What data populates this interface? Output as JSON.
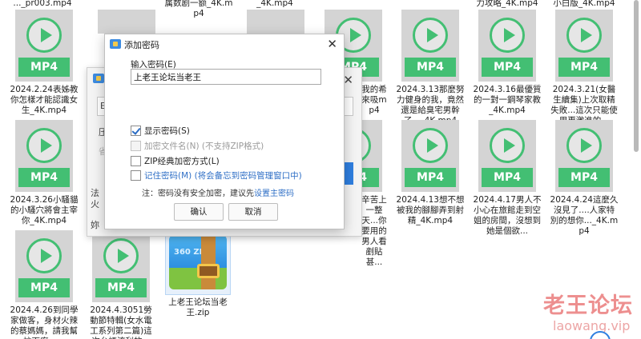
{
  "top_row_partial": [
    "..._pr003.mp4",
    "属数剧一额_4K.mp4",
    "_4K.mp4",
    "力攻略_4K.mp4",
    "小白版_4K.mp4"
  ],
  "files_row1": [
    {
      "name": "2024.2.24表姊教你怎樣才能認識女生_4K.mp4",
      "badge": "MP4"
    },
    {
      "name": "2024.3.13那麼努力健身的我，竟然還是給臭宅男幹了..._4K.mp4",
      "badge": "MP4"
    },
    {
      "name": "2024.3.16最優質的一對一鋼琴家教_4K.mp4",
      "badge": "MP4"
    },
    {
      "name": "2024.3.21(女醫生續集)上次取精失敗...這次只能使用更激進的...",
      "badge": "MP4"
    }
  ],
  "partial_row1_text": "我的希來吸mp4",
  "files_row2": [
    {
      "name": "2024.3.26小騷貓的小騷穴將會主宰你_4K.mp4",
      "badge": "MP4"
    },
    {
      "name": "2024.4.13想不想被我的腳腳弄到射精_4K.mp4",
      "badge": "MP4"
    },
    {
      "name": "2024.4.17男人不小心在旅館走到空姐的房間，沒想到她是個欲...",
      "badge": "MP4"
    },
    {
      "name": "2024.4.24這麼久沒見了....人家特別的想你..._4K.mp4",
      "badge": "MP4"
    }
  ],
  "partial_row2_text": "辛苦上一整天...你要用的男人看剷貼甚...",
  "files_row3": [
    {
      "name": "2024.4.26到同學家做客，身材火辣的蔡媽媽，請我幫忙下廚，...",
      "badge": "MP4"
    },
    {
      "name": "2024.4.3051勞動節特輯(女水電工系列第二篇)這次台語流利的...",
      "badge": "MP4"
    },
    {
      "name": "上老王论坛当老王.zip",
      "badge": "360 ZIP"
    }
  ],
  "bg_dialog": {
    "frag1": "E",
    "frag2": "压",
    "frag3": "火",
    "frag4": "法",
    "frag5": "妳",
    "frag6": "省"
  },
  "dialog": {
    "title": "添加密码",
    "prompt_label": "输入密码(E)",
    "password_value": "上老王论坛当老王",
    "show_password": {
      "label": "显示密码(S)",
      "checked": true
    },
    "encrypt_names": {
      "label": "加密文件名(N) (不支持ZIP格式)",
      "checked": false,
      "disabled": true
    },
    "zip_classic": {
      "label": "ZIP经典加密方式(L)",
      "checked": false
    },
    "remember": {
      "label": "记住密码(M) (将会备忘到密码管理窗口中)",
      "checked": false
    },
    "note_prefix": "注：密码没有安全加密，建议先",
    "note_link": "设置主密码",
    "ok_label": "确认",
    "cancel_label": "取消"
  },
  "watermark": {
    "cn": "老王论坛",
    "en": "laowang.vip"
  }
}
